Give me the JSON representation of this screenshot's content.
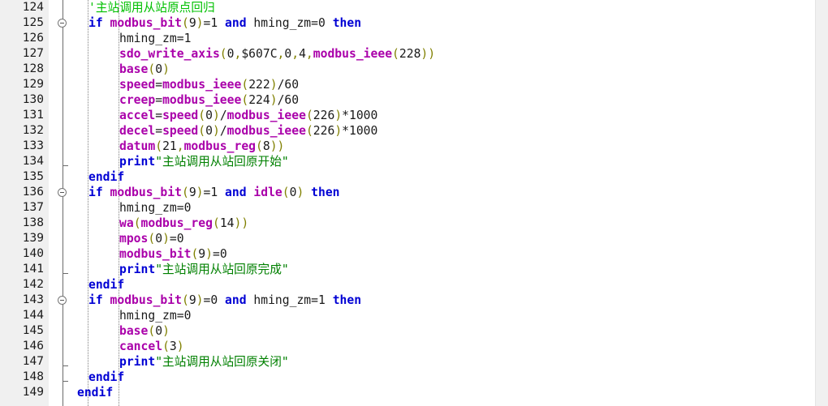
{
  "editor": {
    "kind": "code-editor",
    "language": "Trio BASIC / Motion Perfect",
    "first_visible_line": 124,
    "last_visible_line": 149,
    "line_height_px": 19,
    "colors": {
      "background": "#ffffff",
      "gutter_background": "#f0f0f0",
      "line_number": "#1a1a1a",
      "keyword": "#0000d4",
      "builtin_function": "#aa00aa",
      "comment": "#00c000",
      "string": "#008000",
      "punctuation": "#808000",
      "number": "#1a1a1a",
      "fold_line": "#6b6b6b",
      "indent_guide": "#808080",
      "scrollbar": "#f0f0f0"
    }
  },
  "gutter": {
    "line_numbers": [
      "124",
      "125",
      "126",
      "127",
      "128",
      "129",
      "130",
      "131",
      "132",
      "133",
      "134",
      "135",
      "136",
      "137",
      "138",
      "139",
      "140",
      "141",
      "142",
      "143",
      "144",
      "145",
      "146",
      "147",
      "148",
      "149"
    ],
    "fold_markers": [
      {
        "line": 125,
        "type": "collapse-minus"
      },
      {
        "line": 134,
        "type": "fold-end"
      },
      {
        "line": 136,
        "type": "collapse-minus"
      },
      {
        "line": 141,
        "type": "fold-end"
      },
      {
        "line": 143,
        "type": "collapse-minus"
      },
      {
        "line": 147,
        "type": "fold-end"
      },
      {
        "line": 148,
        "type": "fold-end"
      }
    ]
  },
  "code": {
    "lines": [
      {
        "n": "124",
        "indent": 2,
        "tokens": [
          {
            "t": "'主站调用从站原点回归",
            "c": "cm"
          }
        ]
      },
      {
        "n": "125",
        "indent": 2,
        "tokens": [
          {
            "t": "if",
            "c": "kw"
          },
          {
            "t": " ",
            "c": "op"
          },
          {
            "t": "modbus_bit",
            "c": "fn"
          },
          {
            "t": "(",
            "c": "pn"
          },
          {
            "t": "9",
            "c": "num"
          },
          {
            "t": ")",
            "c": "pn"
          },
          {
            "t": "=",
            "c": "op"
          },
          {
            "t": "1",
            "c": "num"
          },
          {
            "t": " ",
            "c": "op"
          },
          {
            "t": "and",
            "c": "kw"
          },
          {
            "t": " ",
            "c": "op"
          },
          {
            "t": "hming_zm",
            "c": "id"
          },
          {
            "t": "=",
            "c": "op"
          },
          {
            "t": "0",
            "c": "num"
          },
          {
            "t": " ",
            "c": "op"
          },
          {
            "t": "then",
            "c": "kw"
          }
        ]
      },
      {
        "n": "126",
        "indent": 3,
        "tokens": [
          {
            "t": "hming_zm",
            "c": "id"
          },
          {
            "t": "=",
            "c": "op"
          },
          {
            "t": "1",
            "c": "num"
          }
        ]
      },
      {
        "n": "127",
        "indent": 3,
        "tokens": [
          {
            "t": "sdo_write_axis",
            "c": "fn"
          },
          {
            "t": "(",
            "c": "pn"
          },
          {
            "t": "0",
            "c": "num"
          },
          {
            "t": ",",
            "c": "pn"
          },
          {
            "t": "$607C",
            "c": "num"
          },
          {
            "t": ",",
            "c": "pn"
          },
          {
            "t": "0",
            "c": "num"
          },
          {
            "t": ",",
            "c": "pn"
          },
          {
            "t": "4",
            "c": "num"
          },
          {
            "t": ",",
            "c": "pn"
          },
          {
            "t": "modbus_ieee",
            "c": "fn"
          },
          {
            "t": "(",
            "c": "pn"
          },
          {
            "t": "228",
            "c": "num"
          },
          {
            "t": "))",
            "c": "pn"
          }
        ]
      },
      {
        "n": "128",
        "indent": 3,
        "tokens": [
          {
            "t": "base",
            "c": "fn"
          },
          {
            "t": "(",
            "c": "pn"
          },
          {
            "t": "0",
            "c": "num"
          },
          {
            "t": ")",
            "c": "pn"
          }
        ]
      },
      {
        "n": "129",
        "indent": 3,
        "tokens": [
          {
            "t": "speed",
            "c": "fn"
          },
          {
            "t": "=",
            "c": "op"
          },
          {
            "t": "modbus_ieee",
            "c": "fn"
          },
          {
            "t": "(",
            "c": "pn"
          },
          {
            "t": "222",
            "c": "num"
          },
          {
            "t": ")",
            "c": "pn"
          },
          {
            "t": "/",
            "c": "op"
          },
          {
            "t": "60",
            "c": "num"
          }
        ]
      },
      {
        "n": "130",
        "indent": 3,
        "tokens": [
          {
            "t": "creep",
            "c": "fn"
          },
          {
            "t": "=",
            "c": "op"
          },
          {
            "t": "modbus_ieee",
            "c": "fn"
          },
          {
            "t": "(",
            "c": "pn"
          },
          {
            "t": "224",
            "c": "num"
          },
          {
            "t": ")",
            "c": "pn"
          },
          {
            "t": "/",
            "c": "op"
          },
          {
            "t": "60",
            "c": "num"
          }
        ]
      },
      {
        "n": "131",
        "indent": 3,
        "tokens": [
          {
            "t": "accel",
            "c": "fn"
          },
          {
            "t": "=",
            "c": "op"
          },
          {
            "t": "speed",
            "c": "fn"
          },
          {
            "t": "(",
            "c": "pn"
          },
          {
            "t": "0",
            "c": "num"
          },
          {
            "t": ")",
            "c": "pn"
          },
          {
            "t": "/",
            "c": "op"
          },
          {
            "t": "modbus_ieee",
            "c": "fn"
          },
          {
            "t": "(",
            "c": "pn"
          },
          {
            "t": "226",
            "c": "num"
          },
          {
            "t": ")",
            "c": "pn"
          },
          {
            "t": "*",
            "c": "op"
          },
          {
            "t": "1000",
            "c": "num"
          }
        ]
      },
      {
        "n": "132",
        "indent": 3,
        "tokens": [
          {
            "t": "decel",
            "c": "fn"
          },
          {
            "t": "=",
            "c": "op"
          },
          {
            "t": "speed",
            "c": "fn"
          },
          {
            "t": "(",
            "c": "pn"
          },
          {
            "t": "0",
            "c": "num"
          },
          {
            "t": ")",
            "c": "pn"
          },
          {
            "t": "/",
            "c": "op"
          },
          {
            "t": "modbus_ieee",
            "c": "fn"
          },
          {
            "t": "(",
            "c": "pn"
          },
          {
            "t": "226",
            "c": "num"
          },
          {
            "t": ")",
            "c": "pn"
          },
          {
            "t": "*",
            "c": "op"
          },
          {
            "t": "1000",
            "c": "num"
          }
        ]
      },
      {
        "n": "133",
        "indent": 3,
        "tokens": [
          {
            "t": "datum",
            "c": "fn"
          },
          {
            "t": "(",
            "c": "pn"
          },
          {
            "t": "21",
            "c": "num"
          },
          {
            "t": ",",
            "c": "pn"
          },
          {
            "t": "modbus_reg",
            "c": "fn"
          },
          {
            "t": "(",
            "c": "pn"
          },
          {
            "t": "8",
            "c": "num"
          },
          {
            "t": "))",
            "c": "pn"
          }
        ]
      },
      {
        "n": "134",
        "indent": 3,
        "tokens": [
          {
            "t": "print",
            "c": "kw"
          },
          {
            "t": "\"主站调用从站回原开始\"",
            "c": "st"
          }
        ]
      },
      {
        "n": "135",
        "indent": 2,
        "tokens": [
          {
            "t": "endif",
            "c": "kw"
          }
        ]
      },
      {
        "n": "136",
        "indent": 2,
        "tokens": [
          {
            "t": "if",
            "c": "kw"
          },
          {
            "t": " ",
            "c": "op"
          },
          {
            "t": "modbus_bit",
            "c": "fn"
          },
          {
            "t": "(",
            "c": "pn"
          },
          {
            "t": "9",
            "c": "num"
          },
          {
            "t": ")",
            "c": "pn"
          },
          {
            "t": "=",
            "c": "op"
          },
          {
            "t": "1",
            "c": "num"
          },
          {
            "t": " ",
            "c": "op"
          },
          {
            "t": "and",
            "c": "kw"
          },
          {
            "t": " ",
            "c": "op"
          },
          {
            "t": "idle",
            "c": "fn"
          },
          {
            "t": "(",
            "c": "pn"
          },
          {
            "t": "0",
            "c": "num"
          },
          {
            "t": ")",
            "c": "pn"
          },
          {
            "t": " ",
            "c": "op"
          },
          {
            "t": "then",
            "c": "kw"
          }
        ]
      },
      {
        "n": "137",
        "indent": 3,
        "tokens": [
          {
            "t": "hming_zm",
            "c": "id"
          },
          {
            "t": "=",
            "c": "op"
          },
          {
            "t": "0",
            "c": "num"
          }
        ]
      },
      {
        "n": "138",
        "indent": 3,
        "tokens": [
          {
            "t": "wa",
            "c": "fn"
          },
          {
            "t": "(",
            "c": "pn"
          },
          {
            "t": "modbus_reg",
            "c": "fn"
          },
          {
            "t": "(",
            "c": "pn"
          },
          {
            "t": "14",
            "c": "num"
          },
          {
            "t": "))",
            "c": "pn"
          }
        ]
      },
      {
        "n": "139",
        "indent": 3,
        "tokens": [
          {
            "t": "mpos",
            "c": "fn"
          },
          {
            "t": "(",
            "c": "pn"
          },
          {
            "t": "0",
            "c": "num"
          },
          {
            "t": ")",
            "c": "pn"
          },
          {
            "t": "=",
            "c": "op"
          },
          {
            "t": "0",
            "c": "num"
          }
        ]
      },
      {
        "n": "140",
        "indent": 3,
        "tokens": [
          {
            "t": "modbus_bit",
            "c": "fn"
          },
          {
            "t": "(",
            "c": "pn"
          },
          {
            "t": "9",
            "c": "num"
          },
          {
            "t": ")",
            "c": "pn"
          },
          {
            "t": "=",
            "c": "op"
          },
          {
            "t": "0",
            "c": "num"
          }
        ]
      },
      {
        "n": "141",
        "indent": 3,
        "tokens": [
          {
            "t": "print",
            "c": "kw"
          },
          {
            "t": "\"主站调用从站回原完成\"",
            "c": "st"
          }
        ]
      },
      {
        "n": "142",
        "indent": 2,
        "tokens": [
          {
            "t": "endif",
            "c": "kw"
          }
        ]
      },
      {
        "n": "143",
        "indent": 2,
        "tokens": [
          {
            "t": "if",
            "c": "kw"
          },
          {
            "t": " ",
            "c": "op"
          },
          {
            "t": "modbus_bit",
            "c": "fn"
          },
          {
            "t": "(",
            "c": "pn"
          },
          {
            "t": "9",
            "c": "num"
          },
          {
            "t": ")",
            "c": "pn"
          },
          {
            "t": "=",
            "c": "op"
          },
          {
            "t": "0",
            "c": "num"
          },
          {
            "t": " ",
            "c": "op"
          },
          {
            "t": "and",
            "c": "kw"
          },
          {
            "t": " ",
            "c": "op"
          },
          {
            "t": "hming_zm",
            "c": "id"
          },
          {
            "t": "=",
            "c": "op"
          },
          {
            "t": "1",
            "c": "num"
          },
          {
            "t": " ",
            "c": "op"
          },
          {
            "t": "then",
            "c": "kw"
          }
        ]
      },
      {
        "n": "144",
        "indent": 3,
        "tokens": [
          {
            "t": "hming_zm",
            "c": "id"
          },
          {
            "t": "=",
            "c": "op"
          },
          {
            "t": "0",
            "c": "num"
          }
        ]
      },
      {
        "n": "145",
        "indent": 3,
        "tokens": [
          {
            "t": "base",
            "c": "fn"
          },
          {
            "t": "(",
            "c": "pn"
          },
          {
            "t": "0",
            "c": "num"
          },
          {
            "t": ")",
            "c": "pn"
          }
        ]
      },
      {
        "n": "146",
        "indent": 3,
        "tokens": [
          {
            "t": "cancel",
            "c": "fn"
          },
          {
            "t": "(",
            "c": "pn"
          },
          {
            "t": "3",
            "c": "num"
          },
          {
            "t": ")",
            "c": "pn"
          }
        ]
      },
      {
        "n": "147",
        "indent": 3,
        "tokens": [
          {
            "t": "print",
            "c": "kw"
          },
          {
            "t": "\"主站调用从站回原关闭\"",
            "c": "st"
          }
        ]
      },
      {
        "n": "148",
        "indent": 2,
        "tokens": [
          {
            "t": "endif",
            "c": "kw"
          }
        ]
      },
      {
        "n": "149",
        "indent": 1,
        "tokens": [
          {
            "t": "endif",
            "c": "kw"
          }
        ]
      }
    ]
  }
}
